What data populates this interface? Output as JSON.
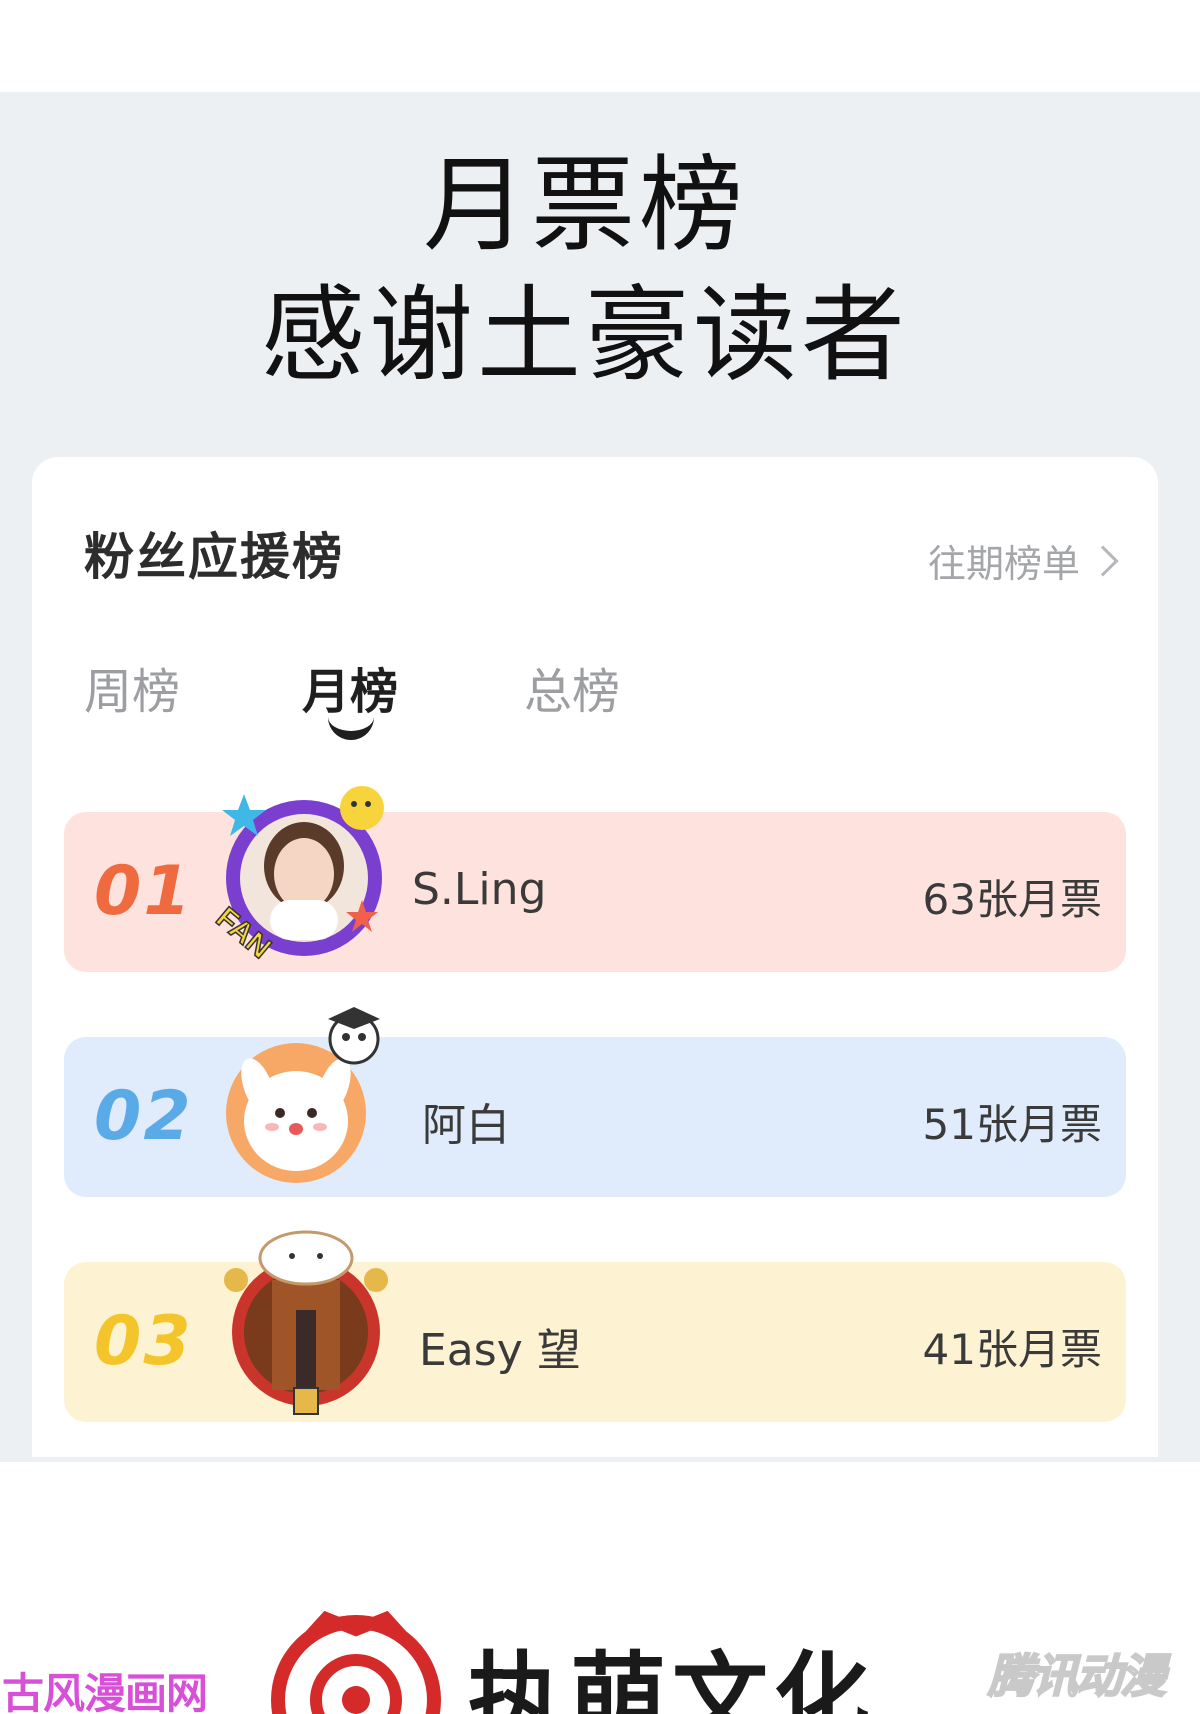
{
  "title": {
    "line1": "月票榜",
    "line2": "感谢土豪读者"
  },
  "card": {
    "header": "粉丝应援榜",
    "history_link": "往期榜单",
    "tabs": [
      {
        "label": "周榜",
        "active": false
      },
      {
        "label": "月榜",
        "active": true
      },
      {
        "label": "总榜",
        "active": false
      }
    ],
    "rankings": [
      {
        "rank": "01",
        "name": "S.Ling",
        "tickets": "63张月票",
        "color": "#fde2de",
        "rank_color": "#f06a3f"
      },
      {
        "rank": "02",
        "name": "阿白",
        "tickets": "51张月票",
        "color": "#e0ecfb",
        "rank_color": "#5aaae8"
      },
      {
        "rank": "03",
        "name": "Easy 望",
        "tickets": "41张月票",
        "color": "#fdf3d3",
        "rank_color": "#f3c52b"
      }
    ]
  },
  "footer": {
    "brand": "执萌文化",
    "watermark_left": "古风漫画网",
    "watermark_right": "腾讯动漫"
  },
  "icons": {
    "history_link": "chevron-right-icon",
    "tab_indicator": "smile-indicator-icon"
  }
}
